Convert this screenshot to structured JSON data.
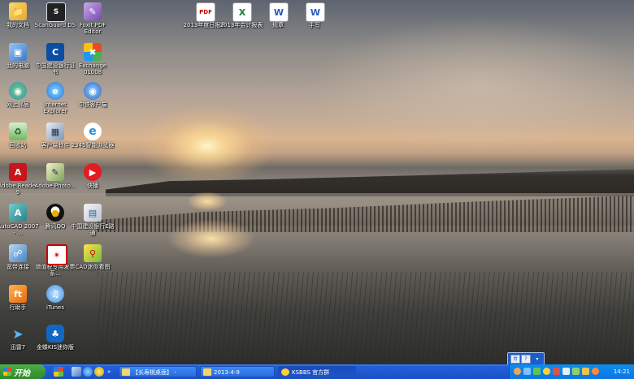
{
  "desktop_icons": [
    {
      "label": "我的文档",
      "icon": "my-documents-icon"
    },
    {
      "label": "我的电脑",
      "icon": "my-computer-icon"
    },
    {
      "label": "网上邻居",
      "icon": "network-places-icon"
    },
    {
      "label": "回收站",
      "icon": "recycle-bin-icon"
    },
    {
      "label": "Adobe Reader 9",
      "icon": "adobe-reader-icon"
    },
    {
      "label": "AutoCAD 2007 - ...",
      "icon": "autocad-icon"
    },
    {
      "label": "宽带连接",
      "icon": "broadband-connection-icon"
    },
    {
      "label": "行助手",
      "icon": "bank-helper-icon"
    },
    {
      "label": "迅雷7",
      "icon": "thunder-icon"
    },
    {
      "label": "ScanGuard DS",
      "icon": "scanguard-icon"
    },
    {
      "label": "中国建设银行证书",
      "icon": "ccb-certificate-icon"
    },
    {
      "label": "Internet Explorer",
      "icon": "internet-explorer-icon"
    },
    {
      "label": "客户端软件",
      "icon": "client-software-icon"
    },
    {
      "label": "Adobe Photo...",
      "icon": "adobe-photoshop-icon"
    },
    {
      "label": "腾讯QQ",
      "icon": "tencent-qq-icon"
    },
    {
      "label": "增值税专用发票系...",
      "icon": "vat-invoice-icon"
    },
    {
      "label": "iTunes",
      "icon": "itunes-icon"
    },
    {
      "label": "金蝶KIS迷你版",
      "icon": "kingdee-kis-icon"
    },
    {
      "label": "Foxit PDF Editor",
      "icon": "foxit-pdf-icon"
    },
    {
      "label": "Exchange 01008",
      "icon": "exchange-icon"
    },
    {
      "label": "中铁客户端",
      "icon": "crec-client-icon"
    },
    {
      "label": "2345智能浏览器",
      "icon": "browser-2345-icon"
    },
    {
      "label": "快播",
      "icon": "qvod-player-icon"
    },
    {
      "label": "中国建设银行E路通",
      "icon": "ccb-eroad-icon"
    },
    {
      "label": "CAD迷你看图",
      "icon": "cad-mini-viewer-icon"
    },
    {
      "label": "2013年度日报表",
      "icon": "pdf-file-icon"
    },
    {
      "label": "2013年会计报表",
      "icon": "excel-file-icon"
    },
    {
      "label": "规章",
      "icon": "word-file-icon"
    },
    {
      "label": "手写",
      "icon": "word-file-icon"
    }
  ],
  "taskbar": {
    "start_label": "开始",
    "tasks": [
      {
        "label": "【长寿桃桌面】 -",
        "icon": "folder-icon"
      },
      {
        "label": "2013-4-9",
        "icon": "folder-icon"
      },
      {
        "label": "KSBBS 官方群",
        "icon": "qq-group-icon"
      }
    ],
    "clock": "14:21"
  },
  "colors": {
    "taskbar": "#245edb",
    "start_button": "#3a9a36",
    "tray": "#0b76df"
  }
}
